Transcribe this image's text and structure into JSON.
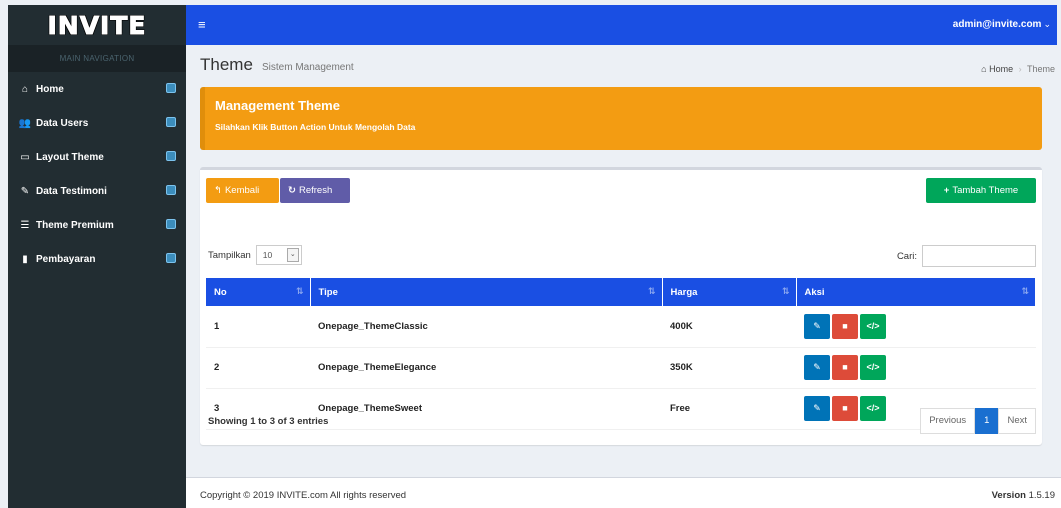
{
  "logo": "INVITE",
  "header": {
    "menu_icon": "bars-icon",
    "user": "admin@invite.com",
    "caret": "⌄"
  },
  "sidebar": {
    "header": "MAIN NAVIGATION",
    "items": [
      {
        "label": "Home",
        "icon": "home-icon",
        "glyph": "⌂"
      },
      {
        "label": "Data Users",
        "icon": "users-icon",
        "glyph": "👥"
      },
      {
        "label": "Layout Theme",
        "icon": "desktop-icon",
        "glyph": "▭"
      },
      {
        "label": "Data Testimoni",
        "icon": "edit-icon",
        "glyph": "✎"
      },
      {
        "label": "Theme Premium",
        "icon": "list-icon",
        "glyph": "☰"
      },
      {
        "label": "Pembayaran",
        "icon": "file-icon",
        "glyph": "▮"
      }
    ]
  },
  "page": {
    "title": "Theme",
    "subtitle": "Sistem Management",
    "breadcrumb": {
      "home": "Home",
      "current": "Theme",
      "home_glyph": "⌂",
      "sep": "›"
    }
  },
  "callout": {
    "title": "Management Theme",
    "text": "Silahkan Klik Button Action Untuk Mengolah Data"
  },
  "toolbar": {
    "back_label": "Kembali",
    "back_glyph": "↰",
    "refresh_label": "Refresh",
    "refresh_glyph": "↻",
    "add_label": "Tambah Theme",
    "add_glyph": "+"
  },
  "table_controls": {
    "length_label": "Tampilkan",
    "length_value": "10",
    "length_arrow": "⌄",
    "search_label": "Cari:",
    "search_value": ""
  },
  "table": {
    "columns": [
      "No",
      "Tipe",
      "Harga",
      "Aksi"
    ],
    "sort_glyph": "⇅",
    "rows": [
      {
        "no": "1",
        "tipe": "Onepage_ThemeClassic",
        "harga": "400K"
      },
      {
        "no": "2",
        "tipe": "Onepage_ThemeElegance",
        "harga": "350K"
      },
      {
        "no": "3",
        "tipe": "Onepage_ThemeSweet",
        "harga": "Free"
      }
    ],
    "action_glyphs": {
      "edit": "✎",
      "delete": "■",
      "code": "</>"
    }
  },
  "pagination": {
    "info": "Showing 1 to 3 of 3 entries",
    "previous": "Previous",
    "page": "1",
    "next": "Next"
  },
  "footer": {
    "copyright": "Copyright © 2019 INVITE.com All rights reserved",
    "version_label": "Version",
    "version": "1.5.19"
  },
  "colors": {
    "navbar": "#1a4fe3",
    "sidebar": "#222d32",
    "callout": "#f39c12",
    "btn_refresh": "#605ca8",
    "btn_add": "#00a65a",
    "btn_edit": "#0073b7",
    "btn_delete": "#dd4b39"
  }
}
